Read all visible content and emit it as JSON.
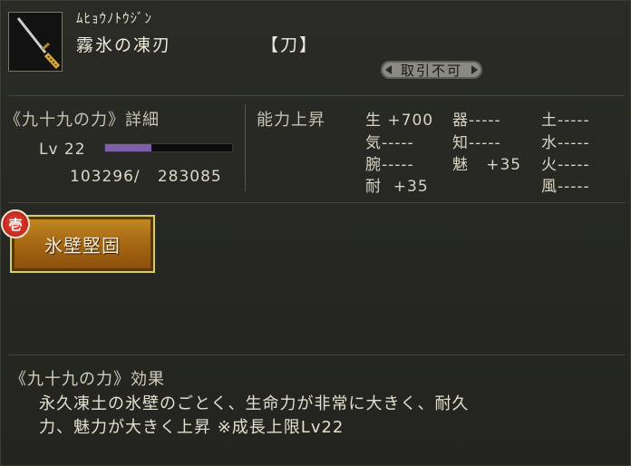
{
  "item": {
    "icon": "katana-icon",
    "ruby": "ﾑﾋｮｳﾉﾄｳｼﾞﾝ",
    "name": "霧氷の凍刃",
    "type": "【刀】",
    "badge": "取引不可"
  },
  "power": {
    "title": "《九十九の力》詳細",
    "level_text": "Lv 22",
    "exp_text": "103296/   283085",
    "exp_progress": 0.365
  },
  "abilities": {
    "title": "能力上昇",
    "col1": [
      "生 +700",
      "気-----",
      "腕-----",
      "耐  +35"
    ],
    "col2": [
      "器-----",
      "知-----",
      "魅   +35"
    ],
    "col3": [
      "土-----",
      "水-----",
      "火-----",
      "風-----"
    ]
  },
  "skill": {
    "number": "壱",
    "name": "氷壁堅固"
  },
  "effect": {
    "title": "《九十九の力》効果",
    "lines": [
      "永久凍土の氷壁のごとく、生命力が非常に大きく、耐久",
      "力、魅力が大きく上昇 ※成長上限Lv22"
    ]
  },
  "colors": {
    "background": "#262722",
    "exp_bar": "#7c5fa8",
    "skill_button": "#a96a14",
    "skill_number": "#c8241a"
  }
}
